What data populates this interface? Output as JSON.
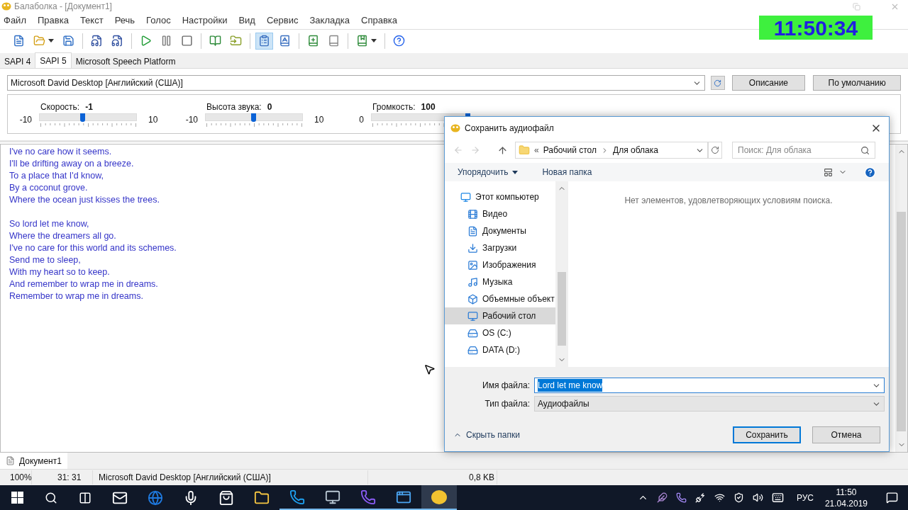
{
  "window": {
    "title": "Балаболка - [Документ1]"
  },
  "menu": [
    "Файл",
    "Правка",
    "Текст",
    "Речь",
    "Голос",
    "Настройки",
    "Вид",
    "Сервис",
    "Закладка",
    "Справка"
  ],
  "toolbar": [
    [
      {
        "selected": false,
        "menu": false
      },
      {
        "selected": false,
        "menu": true
      },
      {
        "selected": false,
        "menu": false
      }
    ],
    [
      {
        "selected": false,
        "menu": false
      },
      {
        "selected": false,
        "menu": false
      }
    ],
    [
      {
        "selected": false,
        "menu": false
      },
      {
        "selected": false,
        "menu": false
      },
      {
        "selected": false,
        "menu": false
      }
    ],
    [
      {
        "selected": false,
        "menu": false
      },
      {
        "selected": false,
        "menu": false
      }
    ],
    [
      {
        "selected": true,
        "menu": false
      },
      {
        "selected": false,
        "menu": false
      }
    ],
    [
      {
        "selected": false,
        "menu": false
      },
      {
        "selected": false,
        "menu": false
      }
    ],
    [
      {
        "selected": false,
        "menu": true
      }
    ],
    [
      {
        "selected": false,
        "menu": false
      }
    ]
  ],
  "clock": "11:50:34",
  "engine_tabs": [
    {
      "label": "SAPI 4",
      "selected": false
    },
    {
      "label": "SAPI 5",
      "selected": true
    },
    {
      "label": "Microsoft Speech Platform",
      "selected": false
    }
  ],
  "voice": {
    "value": "Microsoft David Desktop [Английский (США)]"
  },
  "voice_buttons": [
    "Описание",
    "По умолчанию"
  ],
  "sliders": [
    {
      "label": "Скорость:",
      "value": "-1",
      "min": "-10",
      "max": "10",
      "level": 0.45
    },
    {
      "label": "Высота звука:",
      "value": "0",
      "min": "-10",
      "max": "10",
      "level": 0.5
    },
    {
      "label": "Громкость:",
      "value": "100",
      "min": "0",
      "level": 1
    }
  ],
  "editor": {
    "paragraphs": [
      [
        "I've no care how it seems.",
        "I'll be drifting away on a breeze.",
        "To a place that I'd know,",
        "By a coconut grove.",
        "Where the ocean just kisses the trees."
      ],
      [
        "So lord let me know,",
        "Where the dreamers all go.",
        "I've no care for this world and its schemes.",
        "Send me to sleep,",
        "With my heart so to keep.",
        "And remember to wrap me in dreams.",
        "Remember to wrap me in dreams."
      ]
    ]
  },
  "documents": [
    {
      "label": "Документ1",
      "selected": true
    }
  ],
  "status_bar": [
    "100%",
    "31: 31",
    "Microsoft David Desktop [Английский (США)]",
    "0,8 KB"
  ],
  "dialog": {
    "title": "Сохранить аудиофайл",
    "breadcrumb": {
      "overflow": "«",
      "path": [
        "Рабочий стол",
        "Для облака"
      ]
    },
    "search": {
      "placeholder": "Поиск: Для облака"
    },
    "commands": [
      "Упорядочить",
      "Новая папка"
    ],
    "nav_tree": [
      {
        "label": "Этот компьютер",
        "selected": false,
        "children": [
          {
            "label": "Видео",
            "selected": false
          },
          {
            "label": "Документы",
            "selected": false
          },
          {
            "label": "Загрузки",
            "selected": false
          },
          {
            "label": "Изображения",
            "selected": false
          },
          {
            "label": "Музыка",
            "selected": false
          },
          {
            "label": "Объемные объект",
            "selected": false
          },
          {
            "label": "Рабочий стол",
            "selected": true
          },
          {
            "label": "OS (C:)",
            "selected": false
          },
          {
            "label": "DATA (D:)",
            "selected": false
          }
        ]
      }
    ],
    "empty_message": "Нет элементов, удовлетворяющих условиям поиска.",
    "filename": {
      "label": "Имя файла:",
      "value": "Lord let me know",
      "selected": true
    },
    "filetype": {
      "label": "Тип файла:",
      "value": "Аудиофайлы"
    },
    "hide_folders": "Скрыть папки",
    "buttons": [
      {
        "label": "Сохранить",
        "default": true
      },
      {
        "label": "Отмена",
        "default": false
      }
    ]
  },
  "taskbar": {
    "apps": [
      {
        "running": false,
        "selected": false
      },
      {
        "running": false,
        "selected": false
      },
      {
        "running": false,
        "selected": false
      },
      {
        "running": false,
        "selected": false
      },
      {
        "running": false,
        "selected": false
      },
      {
        "running": true,
        "selected": false
      },
      {
        "running": true,
        "selected": false
      },
      {
        "running": true,
        "selected": false
      },
      {
        "running": true,
        "selected": false
      },
      {
        "running": true,
        "selected": true
      }
    ],
    "language": "РУС",
    "time": "11:50",
    "date": "21.04.2019"
  }
}
